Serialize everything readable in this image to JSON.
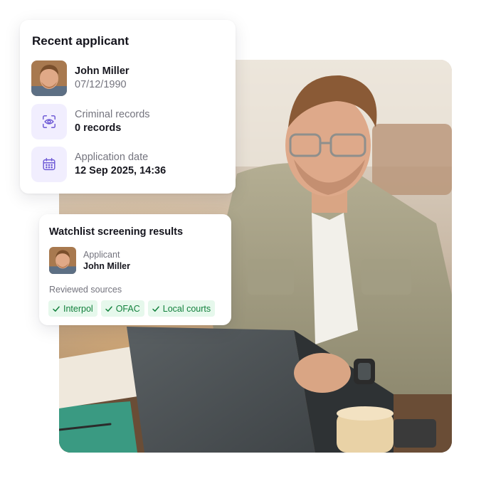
{
  "recent_applicant": {
    "title": "Recent applicant",
    "person": {
      "name": "John Miller",
      "dob": "07/12/1990"
    },
    "criminal": {
      "label": "Criminal records",
      "value": "0 records",
      "icon": "eye-scan-icon"
    },
    "application": {
      "label": "Application date",
      "value": "12 Sep 2025, 14:36",
      "icon": "calendar-icon"
    }
  },
  "watchlist": {
    "title": "Watchlist screening results",
    "applicant_label": "Applicant",
    "applicant_name": "John Miller",
    "sources_label": "Reviewed sources",
    "sources": [
      "Interpol",
      "OFAC",
      "Local courts"
    ]
  },
  "colors": {
    "accent_purple": "#6f5bd6",
    "icon_tile_bg": "#f1eefe",
    "chip_bg": "#e6f8ec",
    "chip_text": "#13813d"
  }
}
